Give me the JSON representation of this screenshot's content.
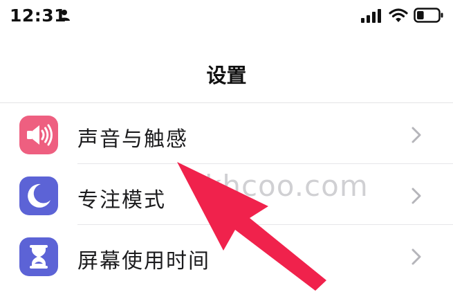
{
  "status_bar": {
    "time": "12:31",
    "icons": [
      "person-icon",
      "signal-icon",
      "wifi-icon",
      "battery-icon"
    ],
    "battery_level": 0.3
  },
  "nav": {
    "title": "设置"
  },
  "settings": {
    "items": [
      {
        "label": "声音与触感",
        "icon": "speaker-icon",
        "icon_color": "#ee5f80"
      },
      {
        "label": "专注模式",
        "icon": "moon-icon",
        "icon_color": "#5c63d6"
      },
      {
        "label": "屏幕使用时间",
        "icon": "hourglass-icon",
        "icon_color": "#5c63d6"
      }
    ]
  },
  "watermark": {
    "text": "khcoo.com"
  },
  "annotation": {
    "arrow_color": "#f0224c",
    "arrow_target": "声音与触感"
  }
}
